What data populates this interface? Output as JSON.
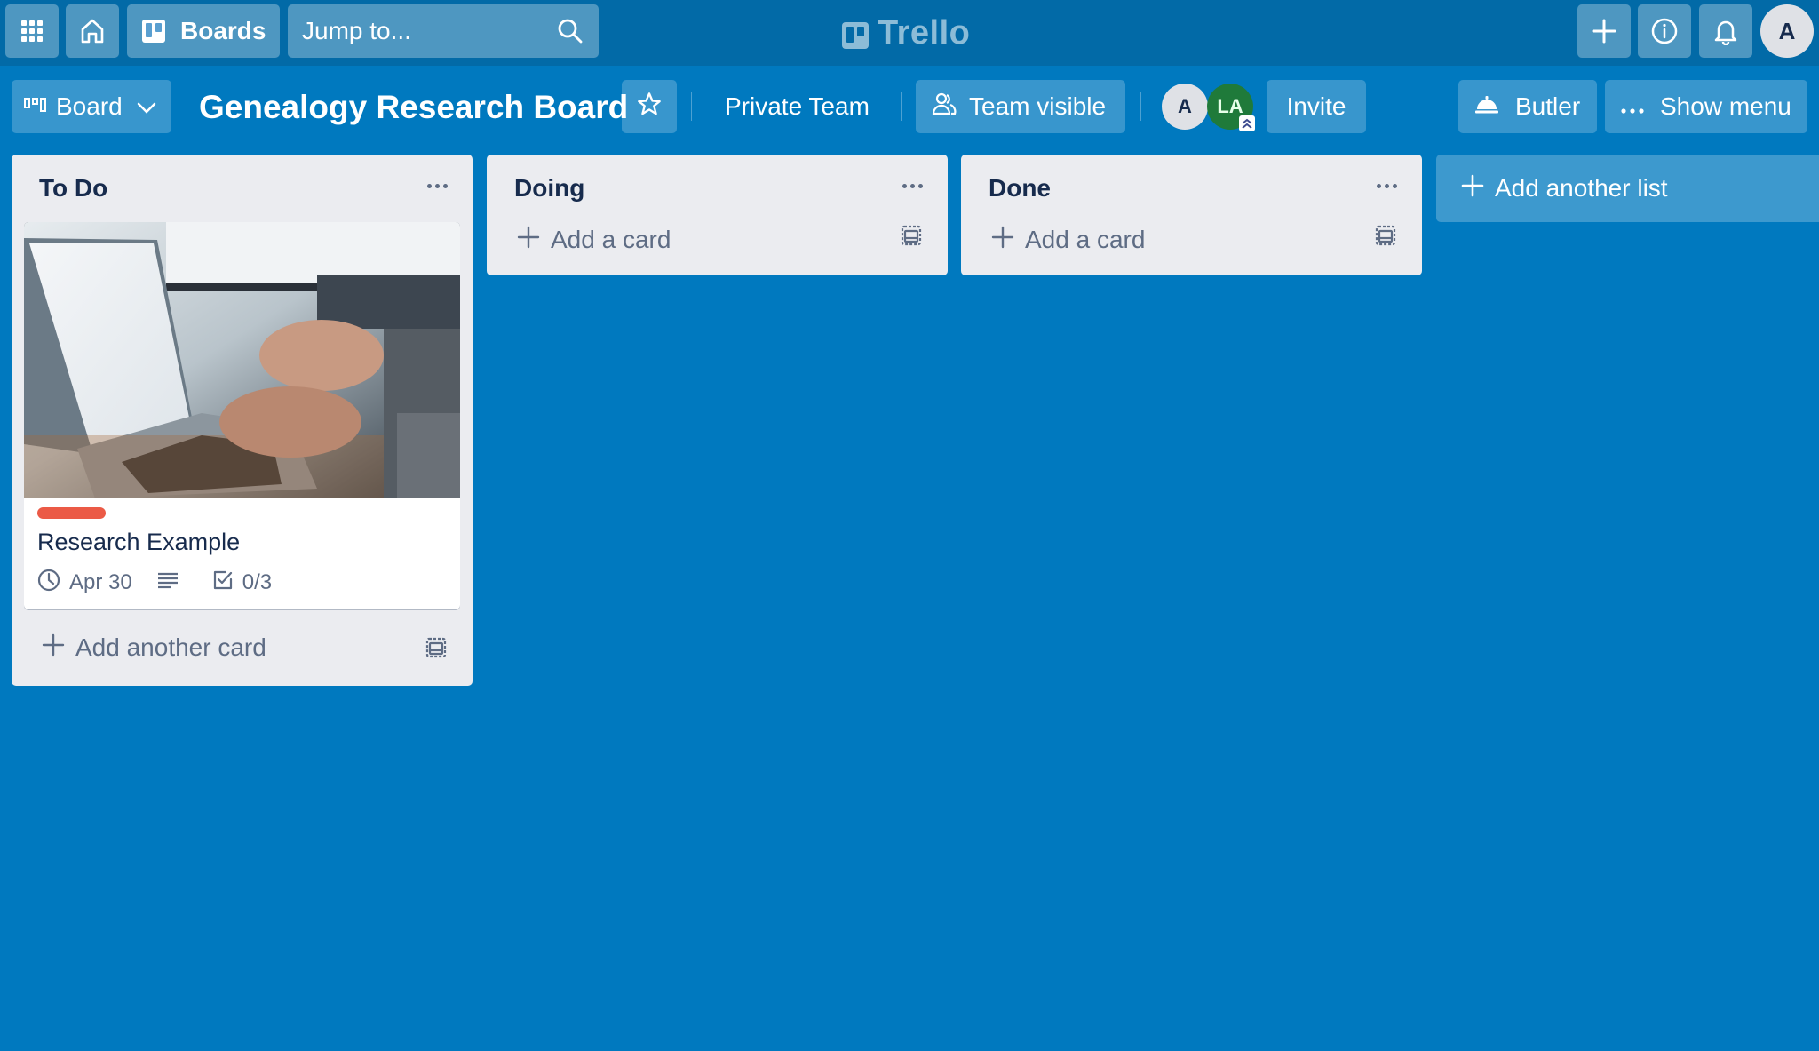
{
  "topbar": {
    "apps_icon": "apps-grid-icon",
    "home_icon": "home-icon",
    "boards_label": "Boards",
    "boards_icon": "boards-icon",
    "search_placeholder": "Jump to...",
    "search_icon": "search-icon",
    "logo_text": "Trello",
    "create_icon": "plus-icon",
    "info_icon": "info-icon",
    "notifications_icon": "bell-icon",
    "user_avatar_initial": "A"
  },
  "board_header": {
    "view_switcher_label": "Board",
    "title": "Genealogy Research Board",
    "star_icon": "star-icon",
    "team_label": "Private Team",
    "visibility_label": "Team visible",
    "members": [
      {
        "initials": "A",
        "color": "#dfe1e6"
      },
      {
        "initials": "LA",
        "color": "#1f7a3a",
        "badge": "admin-chevrons-icon"
      }
    ],
    "invite_label": "Invite",
    "butler_label": "Butler",
    "show_menu_label": "Show menu"
  },
  "lists": [
    {
      "title": "To Do",
      "cards": [
        {
          "cover": "laptop-typing-photo",
          "label_color": "#eb5a46",
          "title": "Research Example",
          "due_date": "Apr 30",
          "has_description": true,
          "checklist": "0/3"
        }
      ],
      "add_label": "Add another card"
    },
    {
      "title": "Doing",
      "cards": [],
      "add_label": "Add a card"
    },
    {
      "title": "Done",
      "cards": [],
      "add_label": "Add a card"
    }
  ],
  "add_list_label": "Add another list",
  "colors": {
    "board_background": "#0079bf",
    "topbar": "#026aa7",
    "list_background": "#ebecf0",
    "label_red": "#eb5a46"
  }
}
